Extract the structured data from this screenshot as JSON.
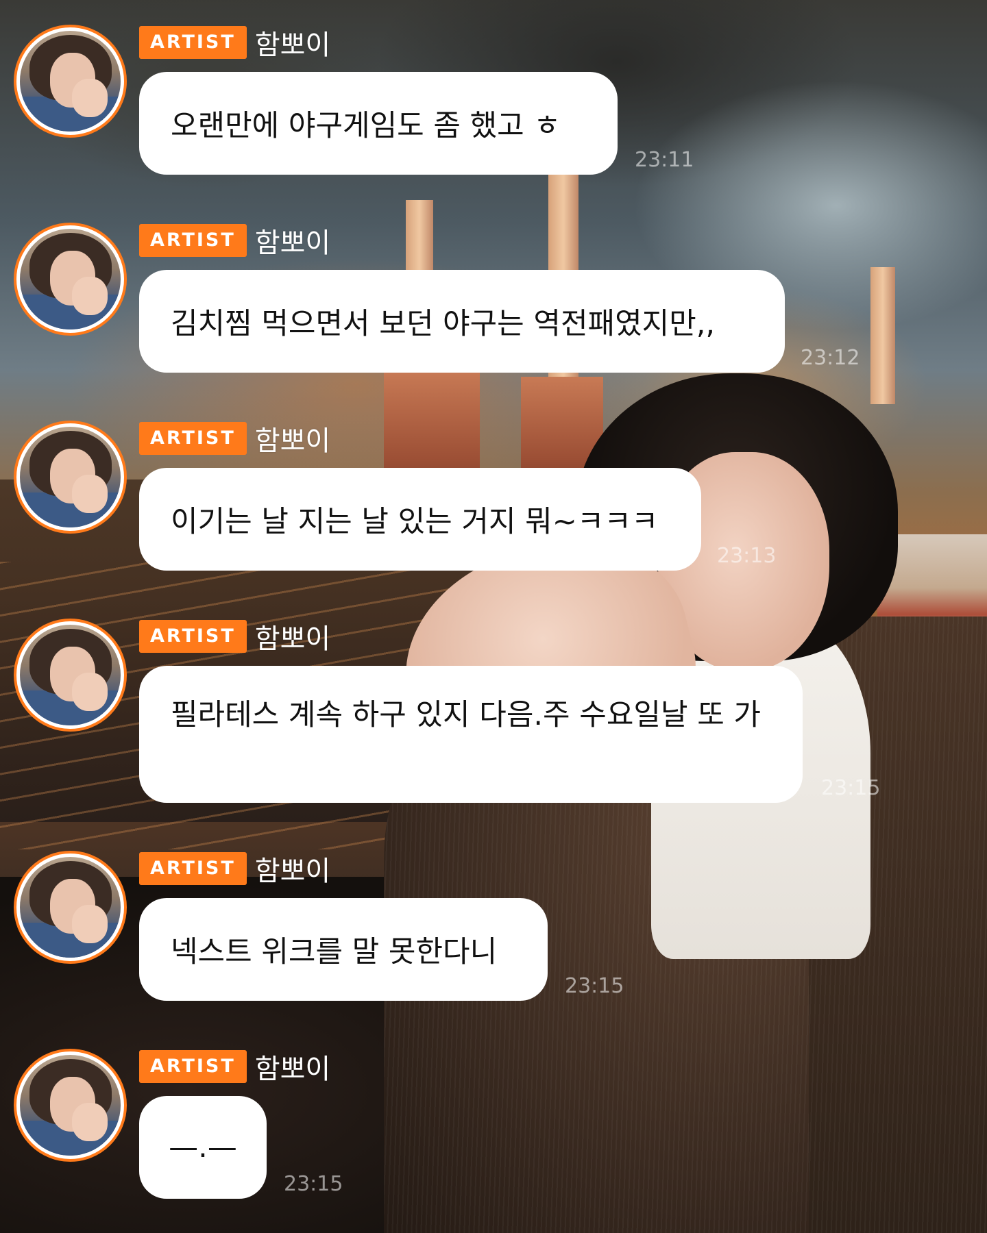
{
  "messages": [
    {
      "badge": "ARTIST",
      "sender": "함뽀이",
      "text": "오랜만에 야구게임도 좀 했고 ㅎ",
      "time": "23:11"
    },
    {
      "badge": "ARTIST",
      "sender": "함뽀이",
      "text": "김치찜 먹으면서 보던 야구는 역전패였지만,,",
      "time": "23:12"
    },
    {
      "badge": "ARTIST",
      "sender": "함뽀이",
      "text": "이기는 날 지는 날 있는 거지 뭐~ㅋㅋㅋ",
      "time": "23:13"
    },
    {
      "badge": "ARTIST",
      "sender": "함뽀이",
      "text": "필라테스 계속 하구 있지 다음.주 수요일날 또 가",
      "time": "23:15"
    },
    {
      "badge": "ARTIST",
      "sender": "함뽀이",
      "text": "넥스트 위크를 말 못한다니",
      "time": "23:15"
    },
    {
      "badge": "ARTIST",
      "sender": "함뽀이",
      "text": "—.—",
      "time": "23:15"
    }
  ],
  "colors": {
    "badge": "#ff7a1a",
    "avatar_ring": "#ff7a1a",
    "bubble": "#ffffff",
    "bubble_text": "#111111",
    "sender_text": "#ffffff"
  },
  "icons": {
    "avatar": "artist-avatar"
  }
}
